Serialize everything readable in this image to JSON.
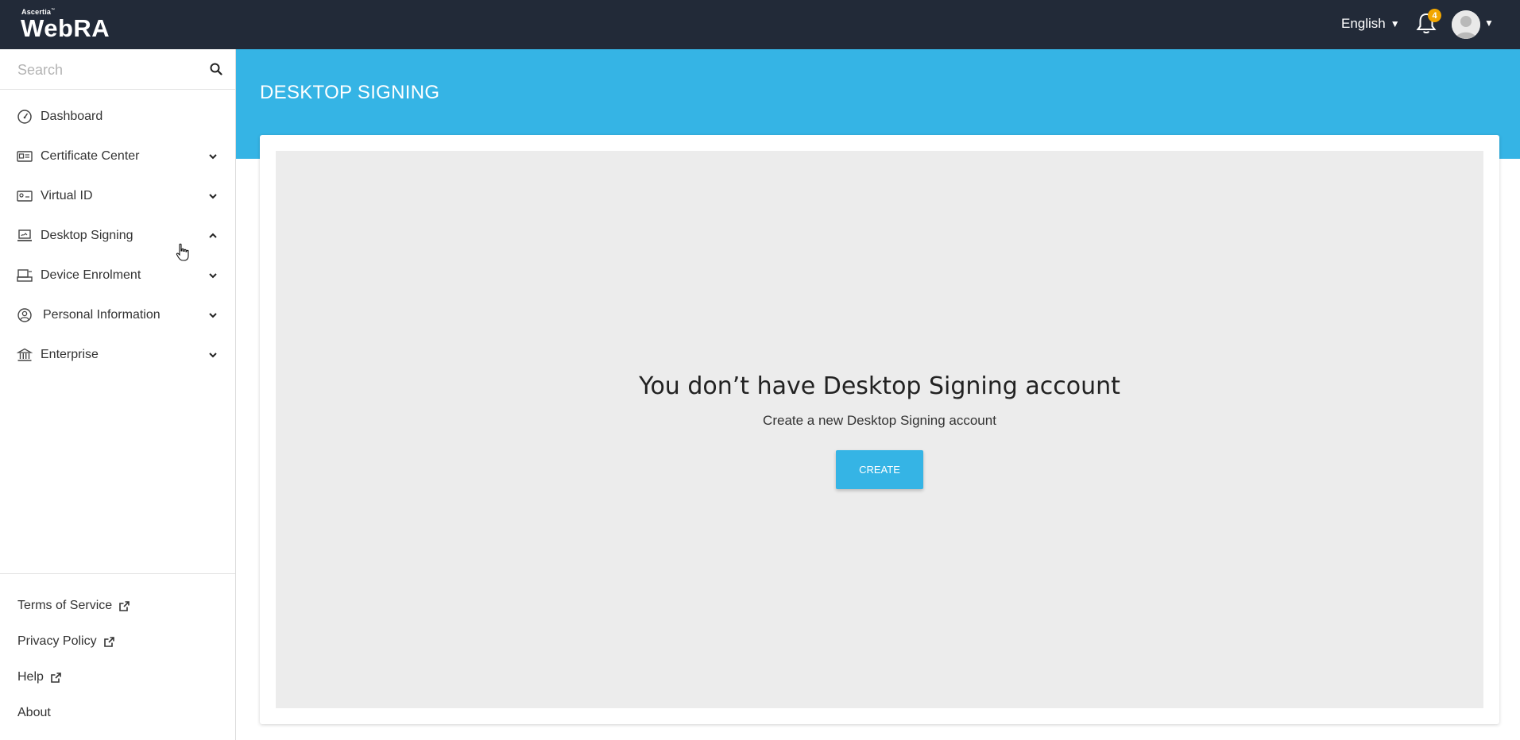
{
  "header": {
    "brand_small": "Ascertia",
    "brand_big": "WebRA",
    "language": "English",
    "notification_count": "4"
  },
  "sidebar": {
    "search_placeholder": "Search",
    "items": [
      {
        "label": "Dashboard",
        "icon": "dashboard-icon",
        "expand": "none"
      },
      {
        "label": "Certificate Center",
        "icon": "certificate-icon",
        "expand": "down"
      },
      {
        "label": "Virtual ID",
        "icon": "id-card-icon",
        "expand": "down"
      },
      {
        "label": "Desktop Signing",
        "icon": "desktop-signing-icon",
        "expand": "up"
      },
      {
        "label": "Device Enrolment",
        "icon": "device-icon",
        "expand": "down"
      },
      {
        "label": "Personal Information",
        "icon": "user-circle-icon",
        "expand": "down"
      },
      {
        "label": "Enterprise",
        "icon": "bank-icon",
        "expand": "down"
      }
    ],
    "footer": {
      "terms": "Terms of Service",
      "privacy": "Privacy Policy",
      "help": "Help",
      "about": "About"
    }
  },
  "main": {
    "title": "DESKTOP SIGNING",
    "empty_heading": "You don’t have Desktop Signing account",
    "empty_sub": "Create a new Desktop Signing account",
    "create_label": "CREATE"
  },
  "colors": {
    "topbar": "#222a38",
    "accent": "#35b4e5",
    "badge": "#f2a600",
    "empty_bg": "#ececec"
  }
}
